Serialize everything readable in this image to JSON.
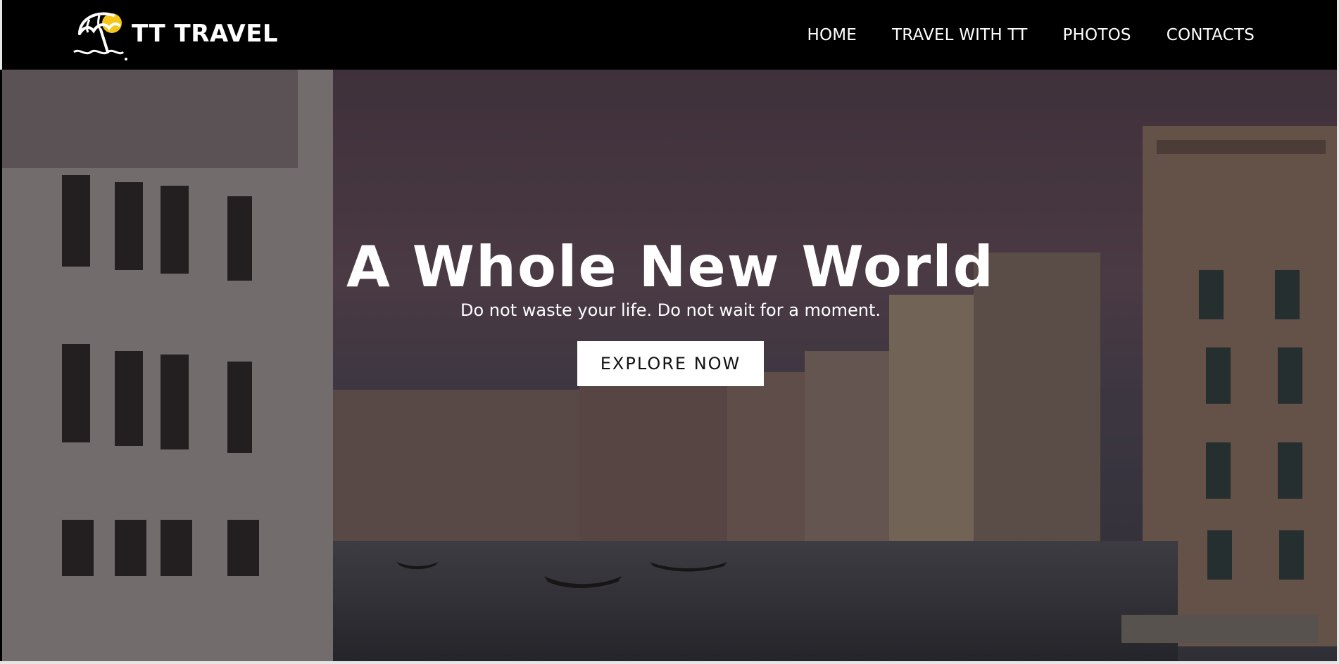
{
  "brand": {
    "name": "TT TRAVEL",
    "logo_icon": "beach-umbrella-icon"
  },
  "nav": {
    "items": [
      {
        "label": "HOME"
      },
      {
        "label": "TRAVEL WITH TT"
      },
      {
        "label": "PHOTOS"
      },
      {
        "label": "CONTACTS"
      }
    ]
  },
  "hero": {
    "title": "A Whole New World",
    "subtitle": "Do not waste your life. Do not wait for a moment.",
    "cta_label": "EXPLORE NOW",
    "background_image": "venice-grand-canal-photo"
  },
  "colors": {
    "navbar": "#000000",
    "text": "#ffffff",
    "accent": "#f5c518",
    "button_bg": "#ffffff"
  }
}
